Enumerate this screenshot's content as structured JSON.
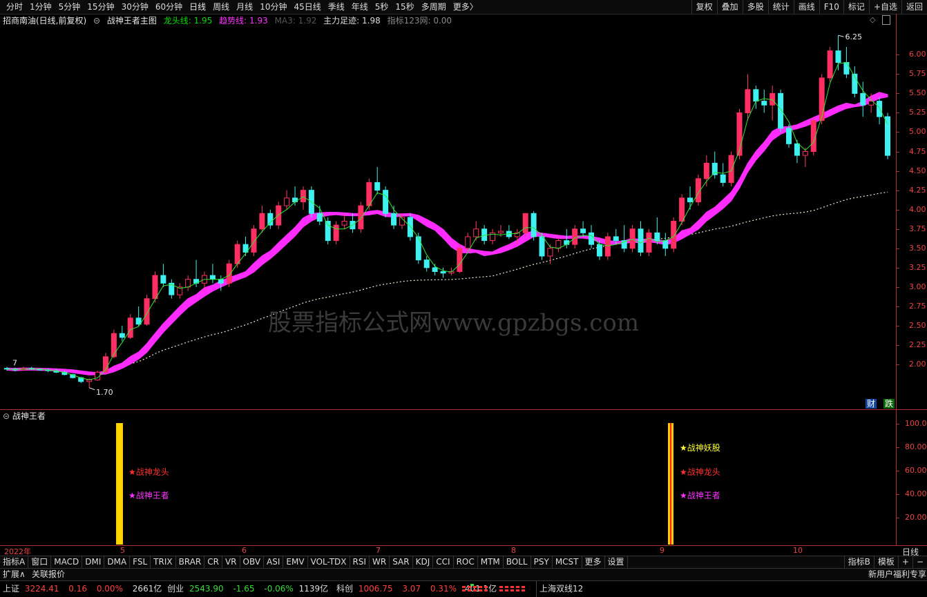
{
  "toolbar": {
    "periods": [
      "分时",
      "1分钟",
      "5分钟",
      "15分钟",
      "30分钟",
      "60分钟",
      "日线",
      "周线",
      "月线",
      "10分钟",
      "45日线",
      "季线",
      "年线",
      "5秒",
      "15秒",
      "多周期",
      "更多〉"
    ],
    "tools": [
      "复权",
      "叠加",
      "多股",
      "统计",
      "画线",
      "F10",
      "标记",
      "+自选",
      "返回"
    ]
  },
  "chart_header": {
    "stock": "招商南油(日线,前复权)",
    "indicator": "战神王者主图",
    "dragon_label": "龙头线: 1.95",
    "trend_label": "趋势线: 1.93",
    "ma_label": "MA3: 1.92",
    "force_label": "主力足迹: 1.98",
    "index_label": "指标123网: 0.00",
    "colors": {
      "dragon": "#00dd00",
      "trend": "#ff33ff",
      "ma": "#555555",
      "force": "#dddddd",
      "index": "#888888"
    }
  },
  "price_axis": [
    "6.00",
    "5.75",
    "5.50",
    "5.25",
    "5.00",
    "4.75",
    "4.50",
    "4.25",
    "4.00",
    "3.75",
    "3.50",
    "3.25",
    "3.00",
    "2.75",
    "2.50",
    "2.25",
    "2.00"
  ],
  "annotations": {
    "high": "6.25",
    "low": "1.70",
    "early": "7"
  },
  "watermark": "股票指标公式网www.gpzbgs.com",
  "badges": {
    "cai": "财",
    "die": "跌"
  },
  "indicator_panel": {
    "title": "战神王者",
    "axis": [
      "100.0",
      "80.00",
      "60.00",
      "40.00",
      "20.00"
    ],
    "signals1": [
      {
        "text": "★战神龙头",
        "color": "#ff3030"
      },
      {
        "text": "★战神王者",
        "color": "#ff33ff"
      }
    ],
    "signals2": [
      {
        "text": "★战神妖股",
        "color": "#ffff33"
      },
      {
        "text": "★战神龙头",
        "color": "#ff3030"
      },
      {
        "text": "★战神王者",
        "color": "#ff33ff"
      }
    ]
  },
  "date_axis": {
    "year": "2022年",
    "months": [
      "5",
      "6",
      "7",
      "8",
      "9",
      "10"
    ],
    "period": "日线"
  },
  "indicator_tabs": [
    "指标A",
    "窗口",
    "MACD",
    "DMI",
    "DMA",
    "FSL",
    "TRIX",
    "BRAR",
    "CR",
    "VR",
    "OBV",
    "ASI",
    "EMV",
    "VOL-TDX",
    "RSI",
    "WR",
    "SAR",
    "KDJ",
    "CCI",
    "ROC",
    "MTM",
    "BOLL",
    "PSY",
    "MCST",
    "更多",
    "设置"
  ],
  "tabs_right": [
    "指标B",
    "模板",
    "+",
    "−"
  ],
  "row2": {
    "expand": "扩展∧",
    "quote": "关联报价",
    "promo": "新用户福利专享"
  },
  "status": {
    "sh_name": "上证",
    "sh_val": "3224.41",
    "sh_chg": "0.16",
    "sh_pct": "0.00%",
    "sh_amt": "2661亿",
    "cy_name": "创业",
    "cy_val": "2543.90",
    "cy_chg": "-1.65",
    "cy_pct": "-0.06%",
    "cy_amt": "1139亿",
    "kc_name": "科创",
    "kc_val": "1006.75",
    "kc_chg": "3.07",
    "kc_pct": "0.31%",
    "kc_amt": "401.1亿",
    "ticker": "上海双线12"
  },
  "chart_data": {
    "type": "candlestick",
    "y_range": [
      1.6,
      6.35
    ],
    "ohlc": [
      [
        1.95,
        1.97,
        1.92,
        1.94
      ],
      [
        1.94,
        1.96,
        1.91,
        1.93
      ],
      [
        1.93,
        1.97,
        1.92,
        1.95
      ],
      [
        1.95,
        1.97,
        1.93,
        1.94
      ],
      [
        1.94,
        1.95,
        1.92,
        1.93
      ],
      [
        1.93,
        1.95,
        1.9,
        1.92
      ],
      [
        1.92,
        1.94,
        1.89,
        1.9
      ],
      [
        1.9,
        1.92,
        1.86,
        1.87
      ],
      [
        1.87,
        1.88,
        1.82,
        1.83
      ],
      [
        1.83,
        1.84,
        1.76,
        1.78
      ],
      [
        1.78,
        1.82,
        1.7,
        1.8
      ],
      [
        1.8,
        1.92,
        1.79,
        1.9
      ],
      [
        1.9,
        2.15,
        1.88,
        2.1
      ],
      [
        2.1,
        2.45,
        2.08,
        2.4
      ],
      [
        2.4,
        2.5,
        2.3,
        2.35
      ],
      [
        2.35,
        2.65,
        2.33,
        2.6
      ],
      [
        2.6,
        2.75,
        2.5,
        2.52
      ],
      [
        2.52,
        2.9,
        2.5,
        2.85
      ],
      [
        2.85,
        3.2,
        2.8,
        3.15
      ],
      [
        3.15,
        3.3,
        3.0,
        3.05
      ],
      [
        3.05,
        3.1,
        2.85,
        2.9
      ],
      [
        2.9,
        3.05,
        2.85,
        3.0
      ],
      [
        3.0,
        3.15,
        2.95,
        3.1
      ],
      [
        3.1,
        3.35,
        3.0,
        3.05
      ],
      [
        3.05,
        3.2,
        2.95,
        3.15
      ],
      [
        3.15,
        3.3,
        3.05,
        3.1
      ],
      [
        3.1,
        3.15,
        2.95,
        3.05
      ],
      [
        3.05,
        3.35,
        3.0,
        3.3
      ],
      [
        3.3,
        3.6,
        3.25,
        3.55
      ],
      [
        3.55,
        3.65,
        3.4,
        3.45
      ],
      [
        3.45,
        3.8,
        3.4,
        3.75
      ],
      [
        3.75,
        4.05,
        3.7,
        3.95
      ],
      [
        3.95,
        4.0,
        3.75,
        3.8
      ],
      [
        3.8,
        4.1,
        3.75,
        4.05
      ],
      [
        4.05,
        4.25,
        4.0,
        4.15
      ],
      [
        4.15,
        4.3,
        4.05,
        4.1
      ],
      [
        4.1,
        4.3,
        4.0,
        4.25
      ],
      [
        4.25,
        4.3,
        3.9,
        3.95
      ],
      [
        3.95,
        4.05,
        3.8,
        3.85
      ],
      [
        3.85,
        3.9,
        3.55,
        3.6
      ],
      [
        3.6,
        3.85,
        3.55,
        3.8
      ],
      [
        3.8,
        3.95,
        3.75,
        3.85
      ],
      [
        3.85,
        3.95,
        3.7,
        3.75
      ],
      [
        3.75,
        4.1,
        3.7,
        4.05
      ],
      [
        4.05,
        4.4,
        4.0,
        4.35
      ],
      [
        4.35,
        4.55,
        4.2,
        4.25
      ],
      [
        4.25,
        4.3,
        3.9,
        3.95
      ],
      [
        3.95,
        4.05,
        3.75,
        3.8
      ],
      [
        3.8,
        3.95,
        3.75,
        3.9
      ],
      [
        3.9,
        3.95,
        3.6,
        3.65
      ],
      [
        3.65,
        3.7,
        3.3,
        3.35
      ],
      [
        3.35,
        3.4,
        3.2,
        3.25
      ],
      [
        3.25,
        3.3,
        3.15,
        3.2
      ],
      [
        3.2,
        3.25,
        3.12,
        3.18
      ],
      [
        3.18,
        3.25,
        3.15,
        3.2
      ],
      [
        3.2,
        3.55,
        3.18,
        3.5
      ],
      [
        3.5,
        3.7,
        3.45,
        3.65
      ],
      [
        3.65,
        3.85,
        3.6,
        3.75
      ],
      [
        3.75,
        3.8,
        3.55,
        3.6
      ],
      [
        3.6,
        3.75,
        3.55,
        3.7
      ],
      [
        3.7,
        3.8,
        3.65,
        3.72
      ],
      [
        3.72,
        3.8,
        3.62,
        3.65
      ],
      [
        3.65,
        3.75,
        3.55,
        3.7
      ],
      [
        3.7,
        3.95,
        3.65,
        3.95
      ],
      [
        3.95,
        3.98,
        3.6,
        3.65
      ],
      [
        3.65,
        3.7,
        3.35,
        3.4
      ],
      [
        3.4,
        3.55,
        3.3,
        3.5
      ],
      [
        3.5,
        3.65,
        3.45,
        3.6
      ],
      [
        3.6,
        3.75,
        3.5,
        3.55
      ],
      [
        3.55,
        3.8,
        3.5,
        3.75
      ],
      [
        3.75,
        3.85,
        3.65,
        3.7
      ],
      [
        3.7,
        3.8,
        3.5,
        3.55
      ],
      [
        3.55,
        3.6,
        3.35,
        3.4
      ],
      [
        3.4,
        3.7,
        3.35,
        3.65
      ],
      [
        3.65,
        3.75,
        3.55,
        3.6
      ],
      [
        3.6,
        3.8,
        3.45,
        3.5
      ],
      [
        3.5,
        3.8,
        3.45,
        3.75
      ],
      [
        3.75,
        3.85,
        3.4,
        3.45
      ],
      [
        3.45,
        3.75,
        3.4,
        3.7
      ],
      [
        3.7,
        3.9,
        3.55,
        3.6
      ],
      [
        3.6,
        3.7,
        3.4,
        3.5
      ],
      [
        3.5,
        3.9,
        3.45,
        3.85
      ],
      [
        3.85,
        4.2,
        3.8,
        4.15
      ],
      [
        4.15,
        4.3,
        4.0,
        4.1
      ],
      [
        4.1,
        4.45,
        4.05,
        4.4
      ],
      [
        4.4,
        4.7,
        4.3,
        4.6
      ],
      [
        4.6,
        4.75,
        4.4,
        4.45
      ],
      [
        4.45,
        4.6,
        4.3,
        4.35
      ],
      [
        4.35,
        4.75,
        4.3,
        4.7
      ],
      [
        4.7,
        5.3,
        4.65,
        5.25
      ],
      [
        5.25,
        5.75,
        5.15,
        5.55
      ],
      [
        5.55,
        5.6,
        5.3,
        5.4
      ],
      [
        5.4,
        5.55,
        5.25,
        5.35
      ],
      [
        5.35,
        5.6,
        5.15,
        5.5
      ],
      [
        5.5,
        5.55,
        5.0,
        5.05
      ],
      [
        5.05,
        5.1,
        4.8,
        4.85
      ],
      [
        4.85,
        4.9,
        4.6,
        4.7
      ],
      [
        4.7,
        4.8,
        4.55,
        4.75
      ],
      [
        4.75,
        5.2,
        4.7,
        5.15
      ],
      [
        5.15,
        5.75,
        5.1,
        5.7
      ],
      [
        5.7,
        6.1,
        5.65,
        6.05
      ],
      [
        6.05,
        6.25,
        5.8,
        5.9
      ],
      [
        5.9,
        6.1,
        5.7,
        5.75
      ],
      [
        5.75,
        5.85,
        5.45,
        5.5
      ],
      [
        5.5,
        5.65,
        5.2,
        5.35
      ],
      [
        5.35,
        5.5,
        5.25,
        5.4
      ],
      [
        5.4,
        5.45,
        5.1,
        5.2
      ],
      [
        5.2,
        5.25,
        4.65,
        4.7
      ]
    ]
  }
}
